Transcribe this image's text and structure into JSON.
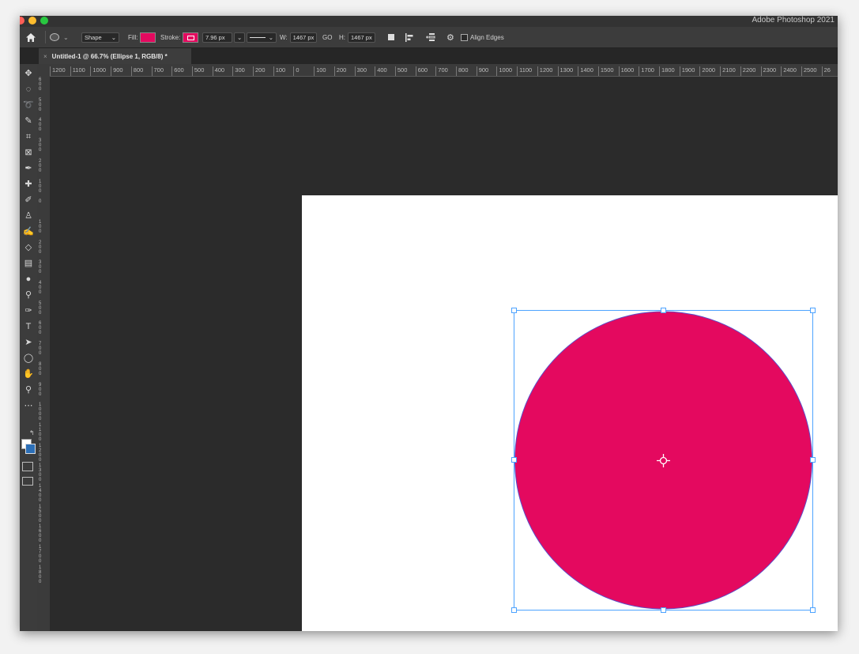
{
  "app": {
    "title": "Adobe Photoshop 2021"
  },
  "colors": {
    "fill": "#e4095f",
    "stroke": "#e4095f",
    "selection": "#4da3ff"
  },
  "options": {
    "mode": "Shape",
    "fill_label": "Fill:",
    "stroke_label": "Stroke:",
    "stroke_width": "7.96 px",
    "width_label": "W:",
    "width_value": "1467 px",
    "link_label": "GO",
    "height_label": "H:",
    "height_value": "1467 px",
    "align_edges": "Align Edges"
  },
  "document": {
    "tab_title": "Untitled-1 @ 66.7% (Ellipse 1, RGB/8) *",
    "tab_close": "×"
  },
  "rulers": {
    "horizontal": [
      "1200",
      "1100",
      "1000",
      "900",
      "800",
      "700",
      "600",
      "500",
      "400",
      "300",
      "200",
      "100",
      "0",
      "100",
      "200",
      "300",
      "400",
      "500",
      "600",
      "700",
      "800",
      "900",
      "1000",
      "1100",
      "1200",
      "1300",
      "1400",
      "1500",
      "1600",
      "1700",
      "1800",
      "1900",
      "2000",
      "2100",
      "2200",
      "2300",
      "2400",
      "2500",
      "26"
    ],
    "vertical": [
      "600",
      "500",
      "400",
      "300",
      "200",
      "100",
      "0",
      "100",
      "200",
      "300",
      "400",
      "500",
      "600",
      "700",
      "800",
      "900",
      "1000",
      "1100",
      "1200",
      "1300",
      "1400",
      "1500",
      "1600",
      "1700",
      "1800"
    ]
  },
  "tools": [
    {
      "name": "move-tool-icon",
      "glyph": "✥"
    },
    {
      "name": "marquee-tool-icon",
      "glyph": "◌"
    },
    {
      "name": "lasso-tool-icon",
      "glyph": "➰"
    },
    {
      "name": "quick-selection-tool-icon",
      "glyph": "✎"
    },
    {
      "name": "crop-tool-icon",
      "glyph": "⌗"
    },
    {
      "name": "frame-tool-icon",
      "glyph": "⊠"
    },
    {
      "name": "eyedropper-tool-icon",
      "glyph": "✒"
    },
    {
      "name": "healing-brush-tool-icon",
      "glyph": "✚"
    },
    {
      "name": "brush-tool-icon",
      "glyph": "✐"
    },
    {
      "name": "clone-stamp-tool-icon",
      "glyph": "♙"
    },
    {
      "name": "history-brush-tool-icon",
      "glyph": "✍"
    },
    {
      "name": "eraser-tool-icon",
      "glyph": "◇"
    },
    {
      "name": "gradient-tool-icon",
      "glyph": "▤"
    },
    {
      "name": "blur-tool-icon",
      "glyph": "●"
    },
    {
      "name": "dodge-tool-icon",
      "glyph": "⚲"
    },
    {
      "name": "pen-tool-icon",
      "glyph": "✑"
    },
    {
      "name": "type-tool-icon",
      "glyph": "T"
    },
    {
      "name": "path-selection-tool-icon",
      "glyph": "➤"
    },
    {
      "name": "ellipse-tool-icon",
      "glyph": "◯"
    },
    {
      "name": "hand-tool-icon",
      "glyph": "✋"
    },
    {
      "name": "zoom-tool-icon",
      "glyph": "⚲"
    },
    {
      "name": "more-tools-icon",
      "glyph": "⋯"
    }
  ]
}
